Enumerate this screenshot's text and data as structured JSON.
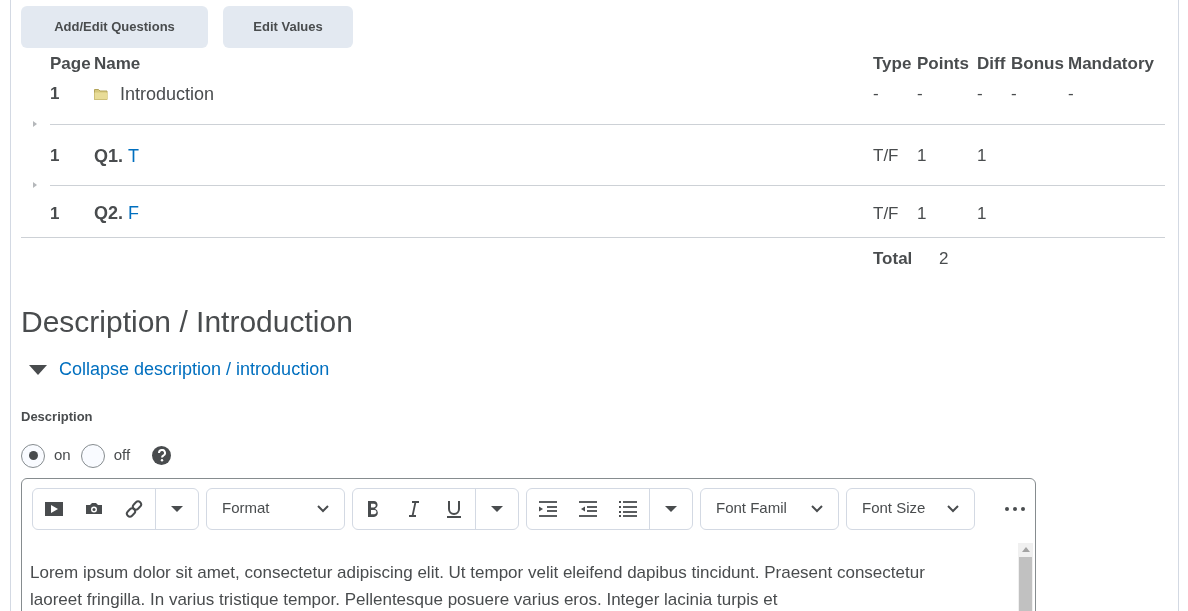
{
  "buttons": [
    "Add/Edit Questions",
    "Edit Values"
  ],
  "table": {
    "columns": [
      "Page",
      "Name",
      "Type",
      "Points",
      "Diff",
      "Bonus",
      "Mandatory"
    ],
    "rows": [
      {
        "kind": "section",
        "page": "1",
        "name": "Introduction",
        "type": "-",
        "points": "-",
        "diff": "-",
        "bonus": "-",
        "mandatory": "-"
      },
      {
        "kind": "question",
        "page": "1",
        "number": "Q1.",
        "title": "T",
        "type": "T/F",
        "points": "1",
        "diff": "1"
      },
      {
        "kind": "question",
        "page": "1",
        "number": "Q2.",
        "title": "F",
        "type": "T/F",
        "points": "1",
        "diff": "1"
      }
    ],
    "total": {
      "label": "Total",
      "value": "2"
    }
  },
  "heading": "Description / Introduction",
  "collapse_link": {
    "label": "Collapse description / introduction",
    "expanded": true
  },
  "description_label": "Description",
  "radios": [
    {
      "label": "on",
      "selected": true
    },
    {
      "label": "off",
      "selected": false
    }
  ],
  "editor": {
    "format": "Format",
    "font_family": "Font Famil",
    "font_size": "Font Size",
    "body": "Lorem ipsum dolor sit amet, consectetur adipiscing elit. Ut tempor velit eleifend dapibus tincidunt. Praesent consectetur laoreet fringilla. In varius tristique tempor. Pellentesque posuere varius eros. Integer lacinia turpis et"
  }
}
